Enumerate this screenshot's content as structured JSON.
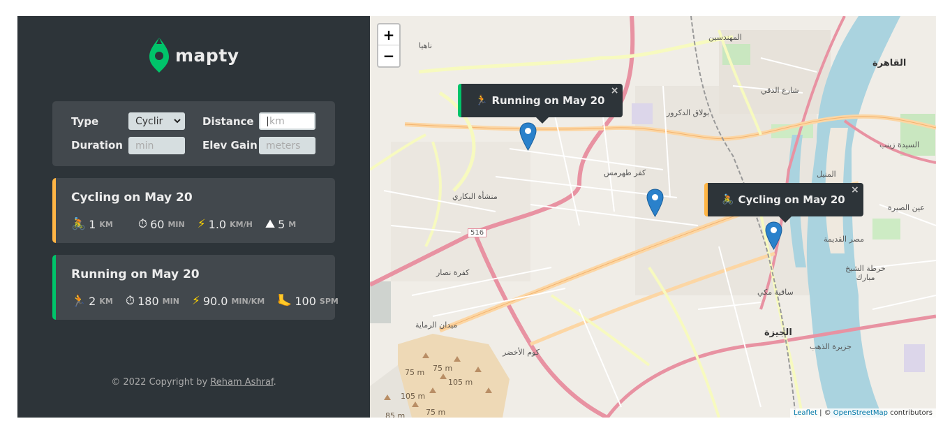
{
  "app": {
    "logo_text": "mapty",
    "form": {
      "type_label": "Type",
      "type_value": "Cyclir",
      "distance_label": "Distance",
      "distance_placeholder": "km",
      "duration_label": "Duration",
      "duration_placeholder": "min",
      "elev_label": "Elev Gain",
      "elev_placeholder": "meters"
    },
    "workouts": [
      {
        "title": "Cycling on May 20",
        "type": "cycling",
        "details": [
          {
            "icon": "🚴",
            "value": "1",
            "unit": "km"
          },
          {
            "icon": "⏱",
            "value": "60",
            "unit": "min"
          },
          {
            "icon": "⚡",
            "value": "1.0",
            "unit": "km/h"
          },
          {
            "icon": "⛰",
            "value": "5",
            "unit": "m"
          }
        ]
      },
      {
        "title": "Running on May 20",
        "type": "running",
        "details": [
          {
            "icon": "🏃",
            "value": "2",
            "unit": "km"
          },
          {
            "icon": "⏱",
            "value": "180",
            "unit": "min"
          },
          {
            "icon": "⚡",
            "value": "90.0",
            "unit": "min/km"
          },
          {
            "icon": "🦶",
            "value": "100",
            "unit": "spm"
          }
        ]
      }
    ],
    "copyright_prefix": "© 2022 Copyright by ",
    "copyright_author": "Reham Ashraf",
    "copyright_suffix": "."
  },
  "map": {
    "zoom_in": "+",
    "zoom_out": "−",
    "popups": {
      "running": {
        "icon": "🏃",
        "text": "Running on May 20",
        "close": "×"
      },
      "cycling": {
        "icon": "🚴",
        "text": "Cycling on May 20",
        "close": "×"
      }
    },
    "labels": {
      "mohandessin": "المهندسين",
      "cairo": "القاهرة",
      "dokki": "شارع الدقي",
      "bulaq": "بولاق الدكرور",
      "kafr": "كفر طهرمس",
      "bakkary": "منشأة البكاري",
      "sayeda": "السيدة زينب",
      "manial": "المنيل",
      "misr": "مصر القديمة",
      "giza": "الجيزة",
      "saqiyat": "ساقية مكي",
      "kafret": "كفرة نصار",
      "remaya": "ميدان الرماية",
      "kom": "كوم الأخضر",
      "zahab": "جزيرة الذهب",
      "sira": "عين الصيرة",
      "khorta": "خرطة الشيخ مبارك",
      "nahya": "ناهيا",
      "road516": "516",
      "m75a": "75 m",
      "m75b": "75 m",
      "m105a": "105 m",
      "m105b": "105 m",
      "m85": "85 m",
      "m75c": "75 m"
    },
    "attribution_leaflet": "Leaflet",
    "attribution_sep": " | © ",
    "attribution_osm": "OpenStreetMap",
    "attribution_suffix": " contributors"
  },
  "colors": {
    "sidebar": "#2d3439",
    "card": "#42484d",
    "brand_green": "#00c46a",
    "brand_orange": "#ffb545",
    "marker_blue": "#2a81cb"
  }
}
